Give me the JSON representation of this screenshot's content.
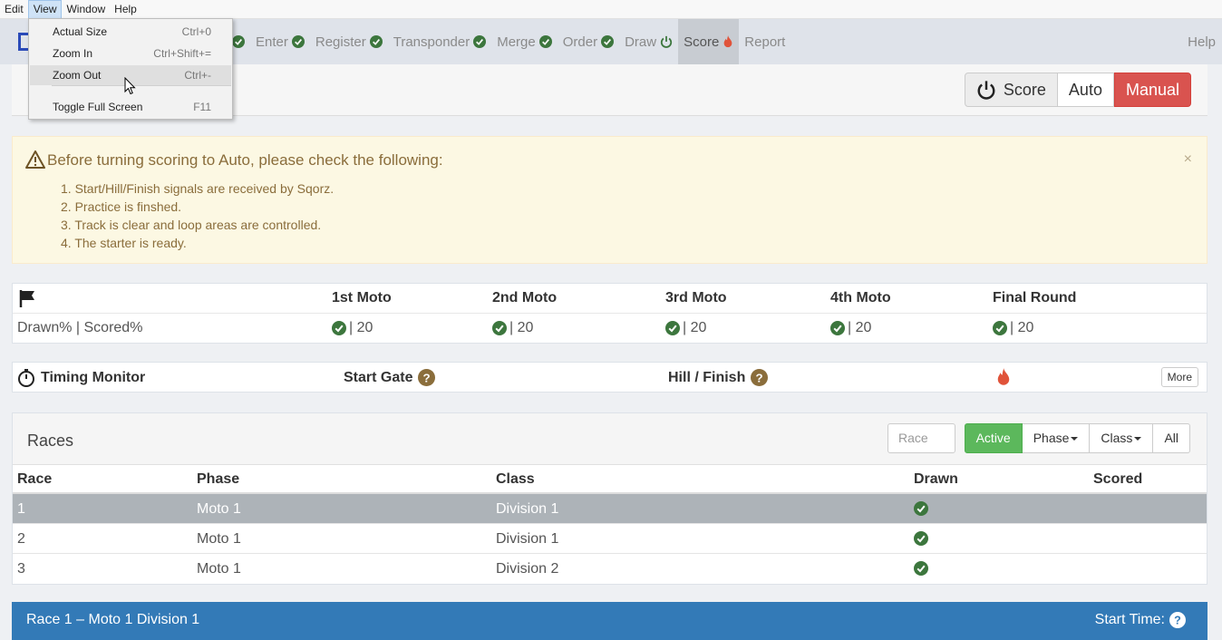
{
  "menubar": {
    "items": [
      "Edit",
      "View",
      "Window",
      "Help"
    ],
    "active": "View"
  },
  "view_menu": {
    "items": [
      {
        "label": "Actual Size",
        "shortcut": "Ctrl+0"
      },
      {
        "label": "Zoom In",
        "shortcut": "Ctrl+Shift+="
      },
      {
        "label": "Zoom Out",
        "shortcut": "Ctrl+-"
      },
      {
        "label": "Toggle Full Screen",
        "shortcut": "F11"
      }
    ],
    "highlighted": "Zoom Out"
  },
  "nav": {
    "items": [
      {
        "label": "Enter",
        "icon": "check-circle-icon"
      },
      {
        "label": "Register",
        "icon": "check-circle-icon"
      },
      {
        "label": "Transponder",
        "icon": "check-circle-icon"
      },
      {
        "label": "Merge",
        "icon": "check-circle-icon"
      },
      {
        "label": "Order",
        "icon": "check-circle-icon"
      },
      {
        "label": "Draw",
        "icon": "power-icon"
      },
      {
        "label": "Score",
        "icon": "fire-icon"
      },
      {
        "label": "Report",
        "icon": ""
      }
    ],
    "active": "Score",
    "help": "Help"
  },
  "score_panel": {
    "score_label": "Score",
    "auto_label": "Auto",
    "manual_label": "Manual"
  },
  "warning": {
    "title": "Before turning scoring to Auto, please check the following:",
    "items": [
      "1. Start/Hill/Finish signals are received by Sqorz.",
      "2. Practice is finshed.",
      "3. Track is clear and loop areas are controlled.",
      "4. The starter is ready."
    ],
    "close": "×"
  },
  "moto_table": {
    "columns": [
      "1st Moto",
      "2nd Moto",
      "3rd Moto",
      "4th Moto",
      "Final Round"
    ],
    "row_label": "Drawn% | Scored%",
    "values": [
      "| 20",
      "| 20",
      "| 20",
      "| 20",
      "| 20"
    ]
  },
  "timing": {
    "title": "Timing Monitor",
    "start_gate": "Start Gate",
    "hill_finish": "Hill / Finish",
    "more": "More"
  },
  "races": {
    "title": "Races",
    "search_placeholder": "Race",
    "filters": {
      "active": "Active",
      "phase": "Phase",
      "class": "Class",
      "all": "All"
    },
    "headers": {
      "race": "Race",
      "phase": "Phase",
      "class": "Class",
      "drawn": "Drawn",
      "scored": "Scored"
    },
    "rows": [
      {
        "race": "1",
        "phase": "Moto 1",
        "class": "Division 1",
        "drawn": true,
        "selected": true
      },
      {
        "race": "2",
        "phase": "Moto 1",
        "class": "Division 1",
        "drawn": true,
        "selected": false
      },
      {
        "race": "3",
        "phase": "Moto 1",
        "class": "Division 2",
        "drawn": true,
        "selected": false
      }
    ]
  },
  "race_header": {
    "title": "Race 1 – Moto 1 Division 1",
    "start_time_label": "Start Time:"
  },
  "colors": {
    "success": "#5cb85c",
    "danger": "#d9534f",
    "primary": "#337ab7",
    "warning_bg": "#fcf8e3",
    "warning_text": "#8a6d3b",
    "check": "#3c763d",
    "fire": "#e0533a"
  }
}
